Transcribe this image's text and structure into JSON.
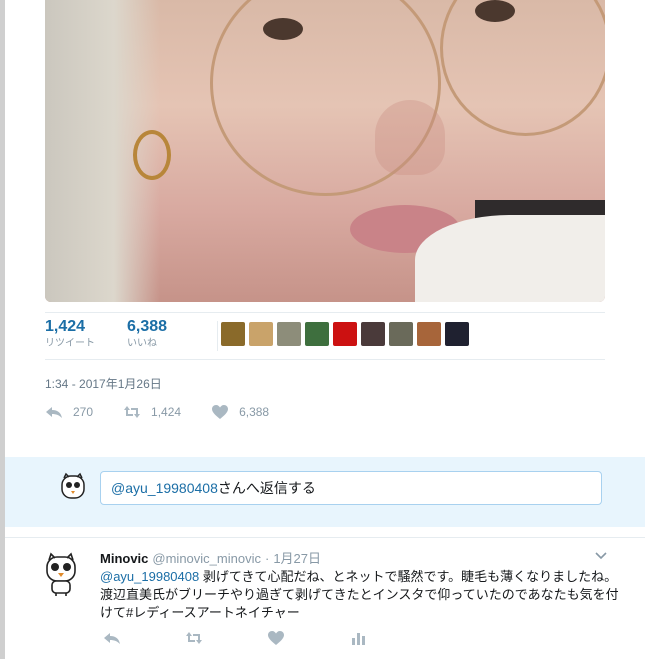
{
  "tweet": {
    "photo_alt": "",
    "retweets": {
      "count": "1,424",
      "label": "リツイート"
    },
    "likes": {
      "count": "6,388",
      "label": "いいね"
    },
    "likers": [
      {
        "color": "#8a6a2a"
      },
      {
        "color": "#c9a36a"
      },
      {
        "color": "#8d8d7a"
      },
      {
        "color": "#3e6f3e"
      },
      {
        "color": "#cc1111"
      },
      {
        "color": "#4a3a3a"
      },
      {
        "color": "#6a6a5a"
      },
      {
        "color": "#a7653a"
      },
      {
        "color": "#1f2130"
      }
    ],
    "timestamp": "1:34 - 2017年1月26日",
    "actions": {
      "reply_count": "270",
      "retweet_count": "1,424",
      "like_count": "6,388"
    }
  },
  "reply_box": {
    "mention": "@ayu_19980408",
    "suffix": "さんへ返信する"
  },
  "reply_tweet": {
    "name": "Minovic",
    "handle": "@minovic_minovic",
    "dot": "·",
    "time": "1月27日",
    "mention": "@ayu_19980408",
    "text": " 剥げてきて心配だね、とネットで騒然です。睫毛も薄くなりましたね。　渡辺直美氏がブリーチやり過ぎて剥げてきたとインスタで仰っていたのであなたも気を付けて#レディースアートネイチャー"
  },
  "colors": {
    "link": "#1b6ea6",
    "muted": "#8899a6",
    "reply_bg": "#e8f5fd"
  },
  "icons": [
    "reply-icon",
    "retweet-icon",
    "heart-icon",
    "chevron-down-icon",
    "analytics-icon"
  ]
}
